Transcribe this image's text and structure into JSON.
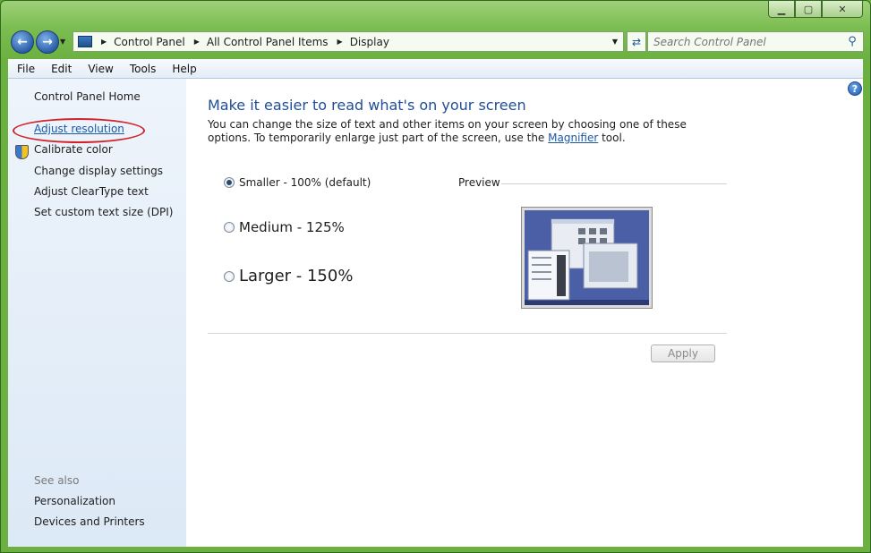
{
  "titlebar": {
    "minimize": "▁",
    "maximize": "▢",
    "close": "✕"
  },
  "address": {
    "crumbs": [
      "Control Panel",
      "All Control Panel Items",
      "Display"
    ]
  },
  "search": {
    "placeholder": "Search Control Panel"
  },
  "menu": [
    "File",
    "Edit",
    "View",
    "Tools",
    "Help"
  ],
  "sidebar": {
    "home": "Control Panel Home",
    "links": [
      "Adjust resolution",
      "Calibrate color",
      "Change display settings",
      "Adjust ClearType text",
      "Set custom text size (DPI)"
    ],
    "see_also_title": "See also",
    "see_also": [
      "Personalization",
      "Devices and Printers"
    ]
  },
  "main": {
    "heading": "Make it easier to read what's on your screen",
    "desc_before": "You can change the size of text and other items on your screen by choosing one of these options. To temporarily enlarge just part of the screen, use the ",
    "desc_link": "Magnifier",
    "desc_after": " tool.",
    "options": [
      "Smaller - 100% (default)",
      "Medium - 125%",
      "Larger - 150%"
    ],
    "selected_option": "Smaller - 100% (default)",
    "preview_label": "Preview",
    "apply_label": "Apply"
  },
  "colors": {
    "accent": "#1f4e98",
    "link": "#1a58a8",
    "highlight_ring": "#d2232a"
  }
}
